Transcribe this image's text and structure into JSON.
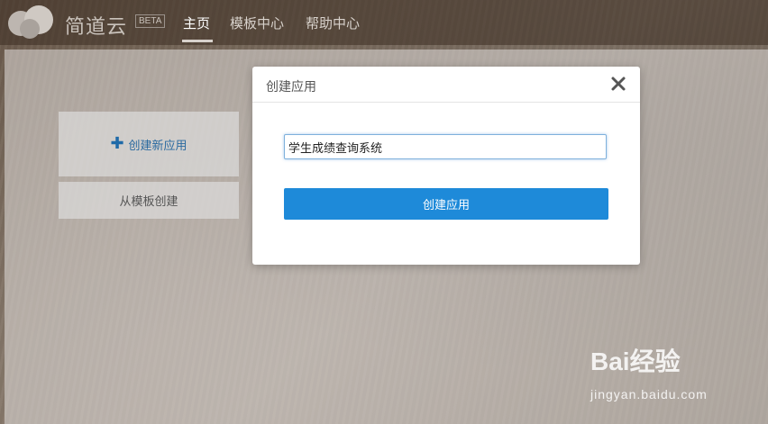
{
  "app": {
    "brand": "简道云",
    "beta": "BETA"
  },
  "nav": {
    "home": "主页",
    "templates": "模板中心",
    "help": "帮助中心"
  },
  "workspace": {
    "create_new_app": "创建新应用",
    "create_from_template": "从模板创建"
  },
  "modal": {
    "title": "创建应用",
    "input_value": "学生成绩查询系统",
    "submit_label": "创建应用"
  },
  "watermark": {
    "logo": "Bai经验",
    "url": "jingyan.baidu.com"
  },
  "colors": {
    "accent": "#1e8ad9",
    "link": "#2b6aa0"
  },
  "icons": {
    "logo": "cloud-logo-icon",
    "plus": "plus-icon",
    "close": "close-icon"
  }
}
